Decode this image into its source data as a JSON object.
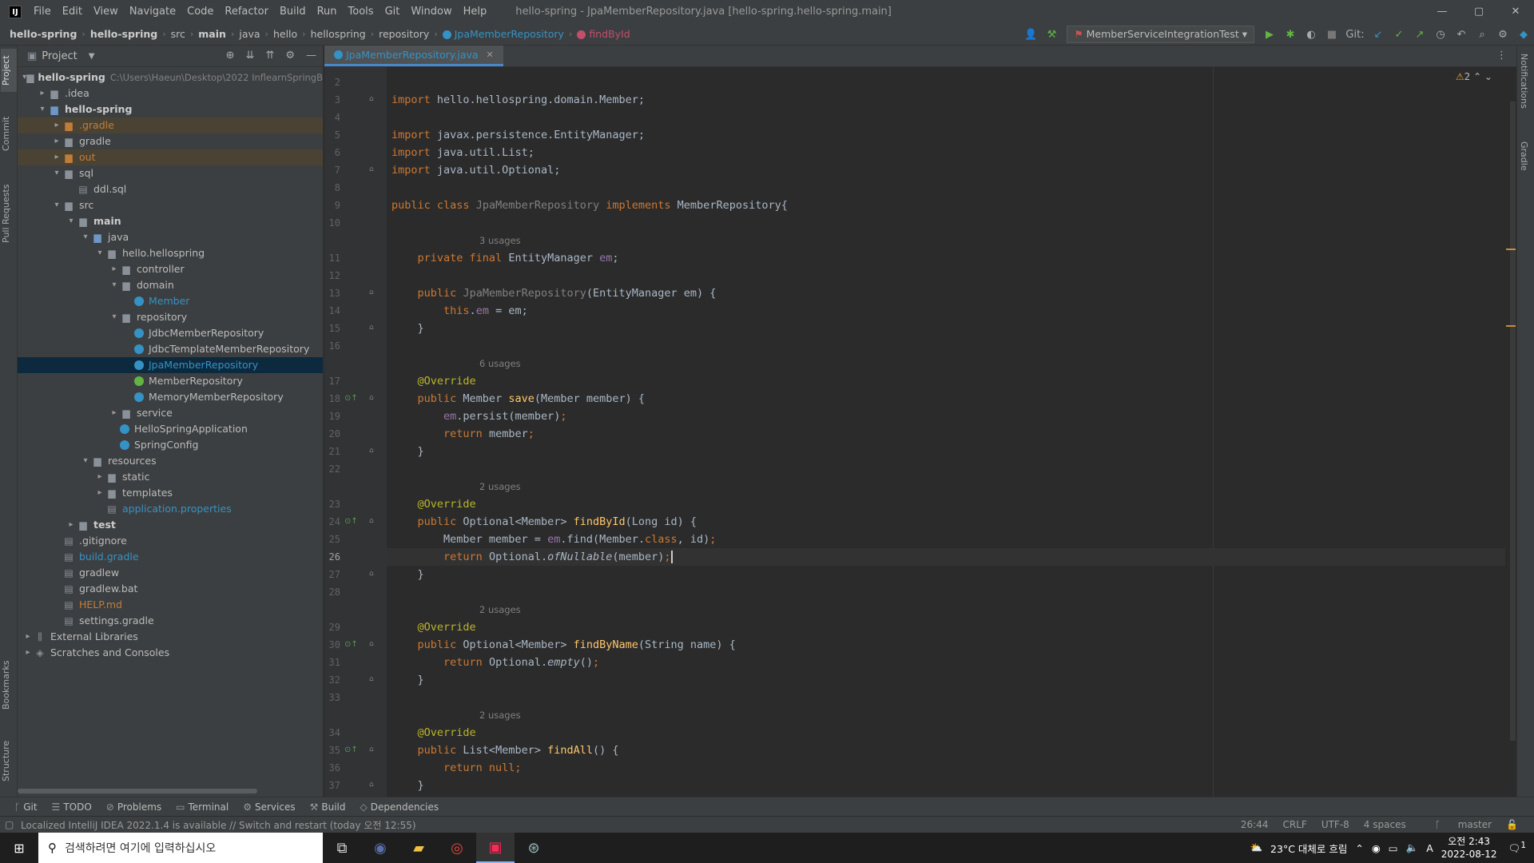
{
  "titlebar": {
    "menu": [
      "File",
      "Edit",
      "View",
      "Navigate",
      "Code",
      "Refactor",
      "Build",
      "Run",
      "Tools",
      "Git",
      "Window",
      "Help"
    ],
    "title": "hello-spring - JpaMemberRepository.java [hello-spring.hello-spring.main]",
    "min": "—",
    "max": "▢",
    "close": "✕"
  },
  "navbar": {
    "crumbs": [
      "hello-spring",
      "hello-spring",
      "src",
      "main",
      "java",
      "hello",
      "hellospring",
      "repository",
      "JpaMemberRepository",
      "findById"
    ],
    "run_config": "MemberServiceIntegrationTest",
    "git_label": "Git:"
  },
  "left_tabs": [
    "Project",
    "Commit",
    "Pull Requests",
    "Bookmarks",
    "Structure"
  ],
  "right_tabs": [
    "Notifications",
    "Gradle"
  ],
  "project": {
    "title": "Project",
    "tree": [
      {
        "label": "hello-spring",
        "extra": "C:\\Users\\Haeun\\Desktop\\2022 InflearnSpringB",
        "depth": 0,
        "arrow": "▾",
        "icon": "folder",
        "style": "bold"
      },
      {
        "label": ".idea",
        "depth": 1,
        "arrow": "▸",
        "icon": "folder",
        "style": ""
      },
      {
        "label": "hello-spring",
        "depth": 1,
        "arrow": "▾",
        "icon": "folder-b",
        "style": "bold"
      },
      {
        "label": ".gradle",
        "depth": 2,
        "arrow": "▸",
        "icon": "folder-o",
        "style": "orange",
        "hl": true
      },
      {
        "label": "gradle",
        "depth": 2,
        "arrow": "▸",
        "icon": "folder",
        "style": ""
      },
      {
        "label": "out",
        "depth": 2,
        "arrow": "▸",
        "icon": "folder-o",
        "style": "orange",
        "hl": true
      },
      {
        "label": "sql",
        "depth": 2,
        "arrow": "▾",
        "icon": "folder",
        "style": ""
      },
      {
        "label": "ddl.sql",
        "depth": 3,
        "arrow": "",
        "icon": "file",
        "style": ""
      },
      {
        "label": "src",
        "depth": 2,
        "arrow": "▾",
        "icon": "folder",
        "style": ""
      },
      {
        "label": "main",
        "depth": 3,
        "arrow": "▾",
        "icon": "folder",
        "style": "bold"
      },
      {
        "label": "java",
        "depth": 4,
        "arrow": "▾",
        "icon": "folder-b",
        "style": ""
      },
      {
        "label": "hello.hellospring",
        "depth": 5,
        "arrow": "▾",
        "icon": "folder",
        "style": ""
      },
      {
        "label": "controller",
        "depth": 6,
        "arrow": "▸",
        "icon": "folder",
        "style": ""
      },
      {
        "label": "domain",
        "depth": 6,
        "arrow": "▾",
        "icon": "folder",
        "style": ""
      },
      {
        "label": "Member",
        "depth": 7,
        "arrow": "",
        "icon": "class",
        "style": "blue"
      },
      {
        "label": "repository",
        "depth": 6,
        "arrow": "▾",
        "icon": "folder",
        "style": ""
      },
      {
        "label": "JdbcMemberRepository",
        "depth": 7,
        "arrow": "",
        "icon": "class",
        "style": ""
      },
      {
        "label": "JdbcTemplateMemberRepository",
        "depth": 7,
        "arrow": "",
        "icon": "class",
        "style": ""
      },
      {
        "label": "JpaMemberRepository",
        "depth": 7,
        "arrow": "",
        "icon": "class",
        "style": "",
        "sel": true
      },
      {
        "label": "MemberRepository",
        "depth": 7,
        "arrow": "",
        "icon": "interface",
        "style": ""
      },
      {
        "label": "MemoryMemberRepository",
        "depth": 7,
        "arrow": "",
        "icon": "class",
        "style": ""
      },
      {
        "label": "service",
        "depth": 6,
        "arrow": "▸",
        "icon": "folder",
        "style": ""
      },
      {
        "label": "HelloSpringApplication",
        "depth": 6,
        "arrow": "",
        "icon": "class",
        "style": ""
      },
      {
        "label": "SpringConfig",
        "depth": 6,
        "arrow": "",
        "icon": "class",
        "style": ""
      },
      {
        "label": "resources",
        "depth": 4,
        "arrow": "▾",
        "icon": "folder",
        "style": ""
      },
      {
        "label": "static",
        "depth": 5,
        "arrow": "▸",
        "icon": "folder",
        "style": ""
      },
      {
        "label": "templates",
        "depth": 5,
        "arrow": "▸",
        "icon": "folder",
        "style": ""
      },
      {
        "label": "application.properties",
        "depth": 5,
        "arrow": "",
        "icon": "file",
        "style": "blue"
      },
      {
        "label": "test",
        "depth": 3,
        "arrow": "▸",
        "icon": "folder",
        "style": "bold"
      },
      {
        "label": ".gitignore",
        "depth": 2,
        "arrow": "",
        "icon": "file",
        "style": ""
      },
      {
        "label": "build.gradle",
        "depth": 2,
        "arrow": "",
        "icon": "file",
        "style": "blue"
      },
      {
        "label": "gradlew",
        "depth": 2,
        "arrow": "",
        "icon": "file",
        "style": ""
      },
      {
        "label": "gradlew.bat",
        "depth": 2,
        "arrow": "",
        "icon": "file",
        "style": ""
      },
      {
        "label": "HELP.md",
        "depth": 2,
        "arrow": "",
        "icon": "file",
        "style": "orange"
      },
      {
        "label": "settings.gradle",
        "depth": 2,
        "arrow": "",
        "icon": "file",
        "style": ""
      },
      {
        "label": "External Libraries",
        "depth": 0,
        "arrow": "▸",
        "icon": "lib",
        "style": ""
      },
      {
        "label": "Scratches and Consoles",
        "depth": 0,
        "arrow": "▸",
        "icon": "scratch",
        "style": ""
      }
    ]
  },
  "editor": {
    "tab_label": "JpaMemberRepository.java",
    "warnings": "2",
    "current_line": "26",
    "lines": [
      {
        "n": "2",
        "html": "",
        "fold": false
      },
      {
        "n": "3",
        "html": "<span class=\"kw\">import</span> hello.hellospring.domain.Member;",
        "fold": true
      },
      {
        "n": "4",
        "html": "",
        "fold": false
      },
      {
        "n": "5",
        "html": "<span class=\"kw\">import</span> javax.persistence.EntityManager;",
        "fold": false
      },
      {
        "n": "6",
        "html": "<span class=\"kw\">import</span> java.util.List;",
        "fold": false
      },
      {
        "n": "7",
        "html": "<span class=\"kw\">import</span> java.util.Optional;",
        "fold": true
      },
      {
        "n": "8",
        "html": "",
        "fold": false
      },
      {
        "n": "9",
        "html": "<span class=\"kw\">public class</span> <span class=\"dim\">JpaMemberRepository</span> <span class=\"kw\">implements</span> MemberRepository{",
        "fold": false
      },
      {
        "n": "10",
        "html": "",
        "fold": false
      },
      {
        "usage": "3 usages"
      },
      {
        "n": "11",
        "html": "    <span class=\"kw\">private final</span> EntityManager <span class=\"fld\">em</span>;",
        "fold": false
      },
      {
        "n": "12",
        "html": "",
        "fold": false
      },
      {
        "n": "13",
        "html": "    <span class=\"kw\">public</span> <span class=\"dim\">JpaMemberRepository</span>(EntityManager em) {",
        "fold": true
      },
      {
        "n": "14",
        "html": "        <span class=\"kw\">this</span>.<span class=\"fld\">em</span> = em;",
        "fold": false
      },
      {
        "n": "15",
        "html": "    }",
        "fold": true
      },
      {
        "n": "16",
        "html": "",
        "fold": false
      },
      {
        "usage": "6 usages"
      },
      {
        "n": "17",
        "html": "    <span class=\"ann\">@Override</span>",
        "fold": false
      },
      {
        "n": "18",
        "html": "    <span class=\"kw\">public</span> Member <span class=\"fn\">save</span>(Member member) {",
        "fold": true,
        "impl": true
      },
      {
        "n": "19",
        "html": "        <span class=\"fld\">em</span>.persist(member)<span class=\"kw\">;</span>",
        "fold": false
      },
      {
        "n": "20",
        "html": "        <span class=\"kw\">return</span> member<span class=\"kw\">;</span>",
        "fold": false
      },
      {
        "n": "21",
        "html": "    }",
        "fold": true
      },
      {
        "n": "22",
        "html": "",
        "fold": false
      },
      {
        "usage": "2 usages"
      },
      {
        "n": "23",
        "html": "    <span class=\"ann\">@Override</span>",
        "fold": false
      },
      {
        "n": "24",
        "html": "    <span class=\"kw\">public</span> Optional&lt;Member&gt; <span class=\"fn\">findById</span>(Long id) {",
        "fold": true,
        "impl": true
      },
      {
        "n": "25",
        "html": "        Member member = <span class=\"fld\">em</span>.find(Member.<span class=\"kw\">class</span>, id)<span class=\"kw\">;</span>",
        "fold": false
      },
      {
        "n": "26",
        "html": "        <span class=\"kw\">return</span> Optional.<span class=\"ital\">ofNullable</span>(member)<span class=\"kw\">;</span><span class=\"caret\"></span>",
        "fold": false,
        "cur": true
      },
      {
        "n": "27",
        "html": "    }",
        "fold": true
      },
      {
        "n": "28",
        "html": "",
        "fold": false
      },
      {
        "usage": "2 usages"
      },
      {
        "n": "29",
        "html": "    <span class=\"ann\">@Override</span>",
        "fold": false
      },
      {
        "n": "30",
        "html": "    <span class=\"kw\">public</span> Optional&lt;Member&gt; <span class=\"fn\">findByName</span>(String name) {",
        "fold": true,
        "impl": true
      },
      {
        "n": "31",
        "html": "        <span class=\"kw\">return</span> Optional.<span class=\"ital\">empty</span>()<span class=\"kw\">;</span>",
        "fold": false
      },
      {
        "n": "32",
        "html": "    }",
        "fold": true
      },
      {
        "n": "33",
        "html": "",
        "fold": false
      },
      {
        "usage": "2 usages"
      },
      {
        "n": "34",
        "html": "    <span class=\"ann\">@Override</span>",
        "fold": false
      },
      {
        "n": "35",
        "html": "    <span class=\"kw\">public</span> List&lt;Member&gt; <span class=\"fn\">findAll</span>() {",
        "fold": true,
        "impl": true
      },
      {
        "n": "36",
        "html": "        <span class=\"kw\">return null;</span>",
        "fold": false
      },
      {
        "n": "37",
        "html": "    }",
        "fold": true
      }
    ]
  },
  "bottom_tools": [
    "Git",
    "TODO",
    "Problems",
    "Terminal",
    "Services",
    "Build",
    "Dependencies"
  ],
  "status": {
    "message": "Localized IntelliJ IDEA 2022.1.4 is available // Switch and restart (today 오전 12:55)",
    "position": "26:44",
    "line_sep": "CRLF",
    "encoding": "UTF-8",
    "indent": "4 spaces",
    "branch": "master"
  },
  "taskbar": {
    "search_placeholder": "검색하려면 여기에 입력하십시오",
    "weather": "23°C  대체로 흐림",
    "ime": "A",
    "time": "오전 2:43",
    "date": "2022-08-12",
    "notif_count": "1"
  }
}
